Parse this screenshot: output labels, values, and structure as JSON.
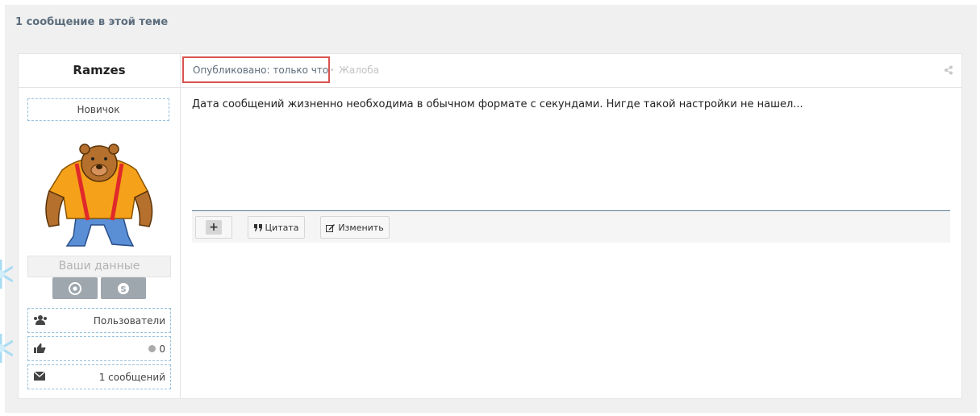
{
  "topic": {
    "count_label": "1 сообщение в этой теме"
  },
  "author": {
    "name": "Ramzes",
    "rank": "Новичок",
    "your_data_label": "Ваши данные",
    "group": "Пользователи",
    "reputation": "0",
    "posts": "1 сообщений"
  },
  "post": {
    "published_label": "Опубликовано: только что",
    "report_label": "Жалоба",
    "content": "Дата сообщений жизненно необходима в обычном формате с секундами. Нигде такой настройки не нашел...",
    "quote_label": "Цитата",
    "edit_label": "Изменить",
    "plus_label": "+"
  },
  "colors": {
    "accent_border": "#d9534f",
    "dashed_border": "#9ac1dd",
    "social_button": "#9ea6ae",
    "divider": "#4a6e8a"
  },
  "icons": [
    "inbox-icon",
    "share-icon",
    "chrome-icon",
    "skype-icon",
    "users-icon",
    "thumbs-up-icon",
    "envelope-icon",
    "quote-icon",
    "edit-icon",
    "snowflake-icon"
  ]
}
